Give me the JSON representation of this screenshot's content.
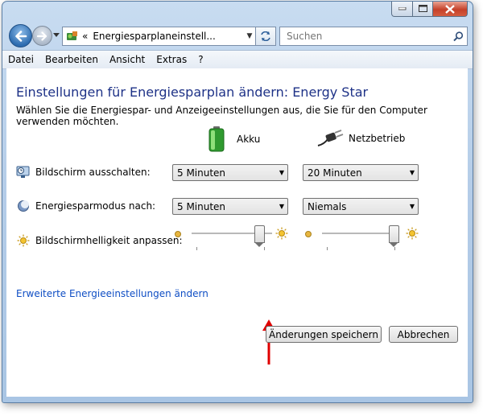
{
  "window": {
    "address": "Energiesparplaneinstell...",
    "address_prefix": "«",
    "search_placeholder": "Suchen"
  },
  "menu": [
    "Datei",
    "Bearbeiten",
    "Ansicht",
    "Extras",
    "?"
  ],
  "page": {
    "title": "Einstellungen für Energiesparplan ändern: Energy Star",
    "subtitle": "Wählen Sie die Energiespar- und Anzeigeeinstellungen aus, die Sie für den Computer verwenden möchten.",
    "columns": {
      "battery": "Akku",
      "plugged": "Netzbetrieb"
    },
    "rows": {
      "display_off": {
        "label": "Bildschirm ausschalten:",
        "battery": "5 Minuten",
        "plugged": "20 Minuten"
      },
      "sleep": {
        "label": "Energiesparmodus nach:",
        "battery": "5 Minuten",
        "plugged": "Niemals"
      },
      "brightness": {
        "label": "Bildschirmhelligkeit anpassen:",
        "battery_level": 0.9,
        "plugged_level": 1.0
      }
    },
    "advanced_link": "Erweiterte Energieeinstellungen ändern",
    "save_button": "Änderungen speichern",
    "cancel_button": "Abbrechen"
  },
  "colors": {
    "title": "#1e3287",
    "link": "#0f4ec4",
    "annotation_arrow": "#e00000"
  }
}
